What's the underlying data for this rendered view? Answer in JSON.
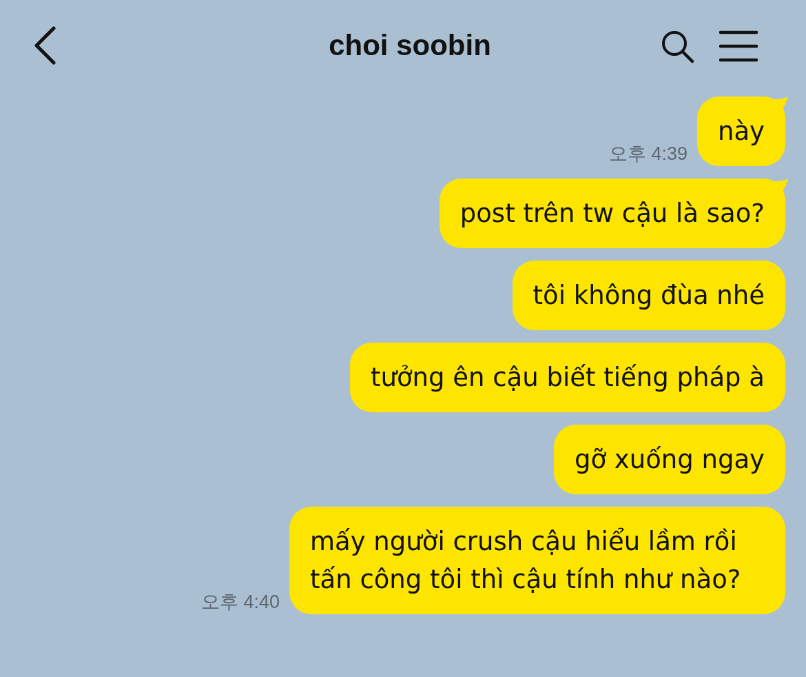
{
  "header": {
    "title": "choi soobin"
  },
  "messages": [
    {
      "text": "này",
      "time": "오후 4:39",
      "tail": true
    },
    {
      "text": "post trên tw cậu là sao?",
      "tail": true
    },
    {
      "text": "tôi không đùa nhé",
      "tail": false
    },
    {
      "text": "tưởng ên cậu biết tiếng pháp à",
      "tail": false
    },
    {
      "text": "gỡ xuống ngay",
      "tail": false
    },
    {
      "text": "mấy người crush cậu hiểu lầm rồi tấn công tôi thì cậu tính như nào?",
      "time": "오후 4:40",
      "tail": false
    }
  ]
}
